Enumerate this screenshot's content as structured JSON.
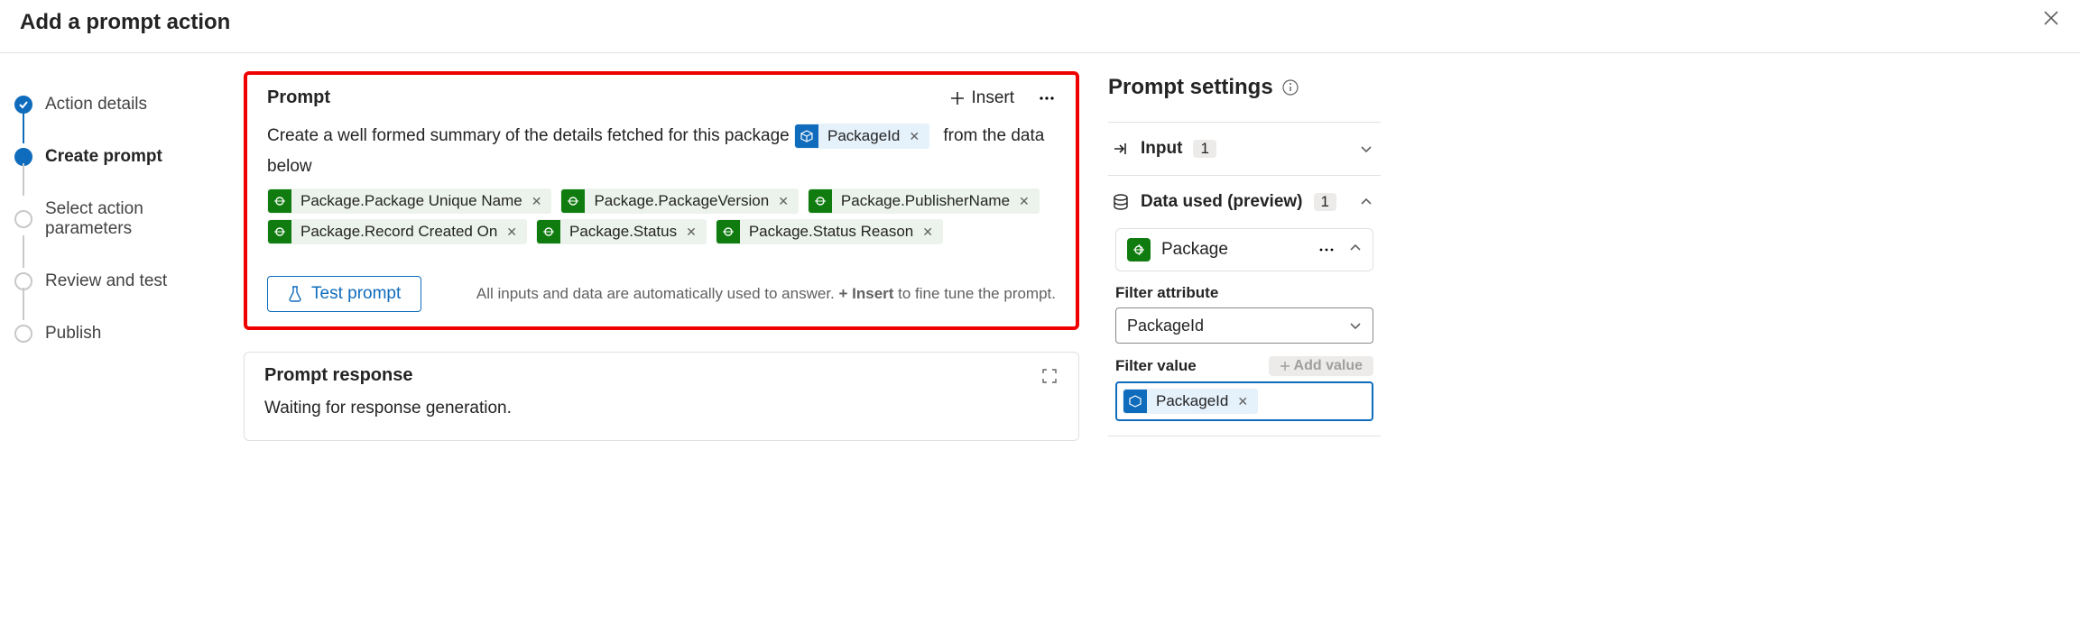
{
  "header": {
    "title": "Add a prompt action"
  },
  "stepper": {
    "steps": [
      {
        "label": "Action details",
        "state": "done"
      },
      {
        "label": "Create prompt",
        "state": "active"
      },
      {
        "label": "Select action parameters",
        "state": ""
      },
      {
        "label": "Review and test",
        "state": ""
      },
      {
        "label": "Publish",
        "state": ""
      }
    ]
  },
  "prompt_card": {
    "title": "Prompt",
    "insert_label": "Insert",
    "text_before": "Create a well formed summary of the details fetched for this package",
    "text_after": "from the data below",
    "id_token": "PackageId",
    "tokens": [
      "Package.Package Unique Name",
      "Package.PackageVersion",
      "Package.PublisherName",
      "Package.Record Created On",
      "Package.Status",
      "Package.Status Reason"
    ],
    "test_label": "Test prompt",
    "hint_prefix": "All inputs and data are automatically used to answer. ",
    "hint_bold": "+ Insert",
    "hint_suffix": " to fine tune the prompt."
  },
  "response_card": {
    "title": "Prompt response",
    "body": "Waiting for response generation."
  },
  "settings": {
    "title": "Prompt settings",
    "input_label": "Input",
    "input_count": "1",
    "data_label": "Data used (preview)",
    "data_count": "1",
    "package_label": "Package",
    "filter_attr_label": "Filter attribute",
    "filter_attr_value": "PackageId",
    "filter_value_label": "Filter value",
    "add_value_label": "Add value",
    "filter_value_token": "PackageId"
  }
}
